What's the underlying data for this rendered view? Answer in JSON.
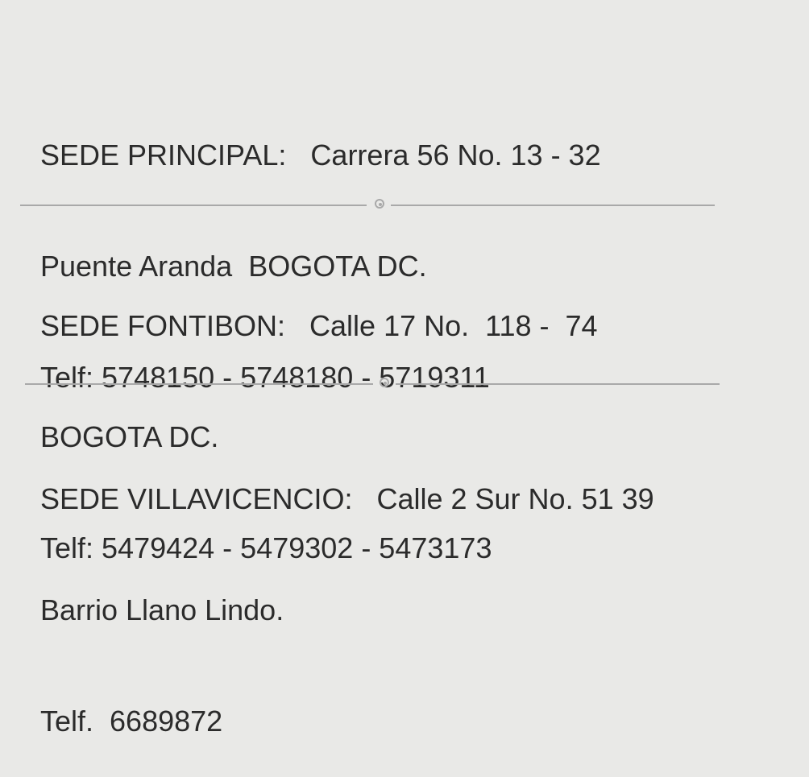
{
  "sedes": [
    {
      "line1": "SEDE PRINCIPAL:   Carrera 56 No. 13 - 32",
      "line2": "Puente Aranda  BOGOTA DC.",
      "line3": "Telf: 5748150 - 5748180 - 5719311"
    },
    {
      "line1": "SEDE FONTIBON:   Calle 17 No.  118 -  74",
      "line2": "BOGOTA DC.",
      "line3": "Telf: 5479424 - 5479302 - 5473173"
    },
    {
      "line1": "SEDE VILLAVICENCIO:   Calle 2 Sur No. 51 39",
      "line2": "Barrio Llano Lindo.",
      "line3": "Telf.  6689872"
    }
  ],
  "colors": {
    "background": "#e9e9e7",
    "text": "#2b2b2b",
    "divider": "#a9a9a9"
  }
}
